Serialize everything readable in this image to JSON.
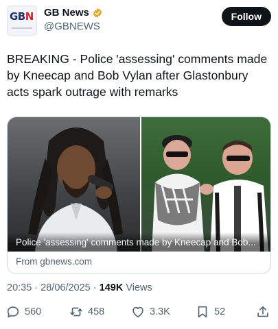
{
  "account": {
    "name": "GB News",
    "handle": "@GBNEWS",
    "logo_text_blue": "GB",
    "logo_text_red": "N",
    "verified_badge_color": "#e0a82e",
    "follow_label": "Follow"
  },
  "tweet": {
    "text": "BREAKING -   Police 'assessing' comments made by Kneecap and Bob Vylan after Glastonbury acts spark outrage with remarks"
  },
  "card": {
    "caption": "Police 'assessing' comments made by Kneecap and Bob...",
    "source": "From gbnews.com"
  },
  "meta": {
    "time_date": "20:35 · 28/06/2025 · ",
    "views_count": "149K",
    "views_label": " Views"
  },
  "actions": {
    "replies": "560",
    "reposts": "458",
    "likes": "3.3K",
    "bookmarks": "52"
  },
  "colors": {
    "text_primary": "#0f1419",
    "text_secondary": "#536471",
    "follow_bg": "#0f1419",
    "border": "#cfd9de"
  }
}
